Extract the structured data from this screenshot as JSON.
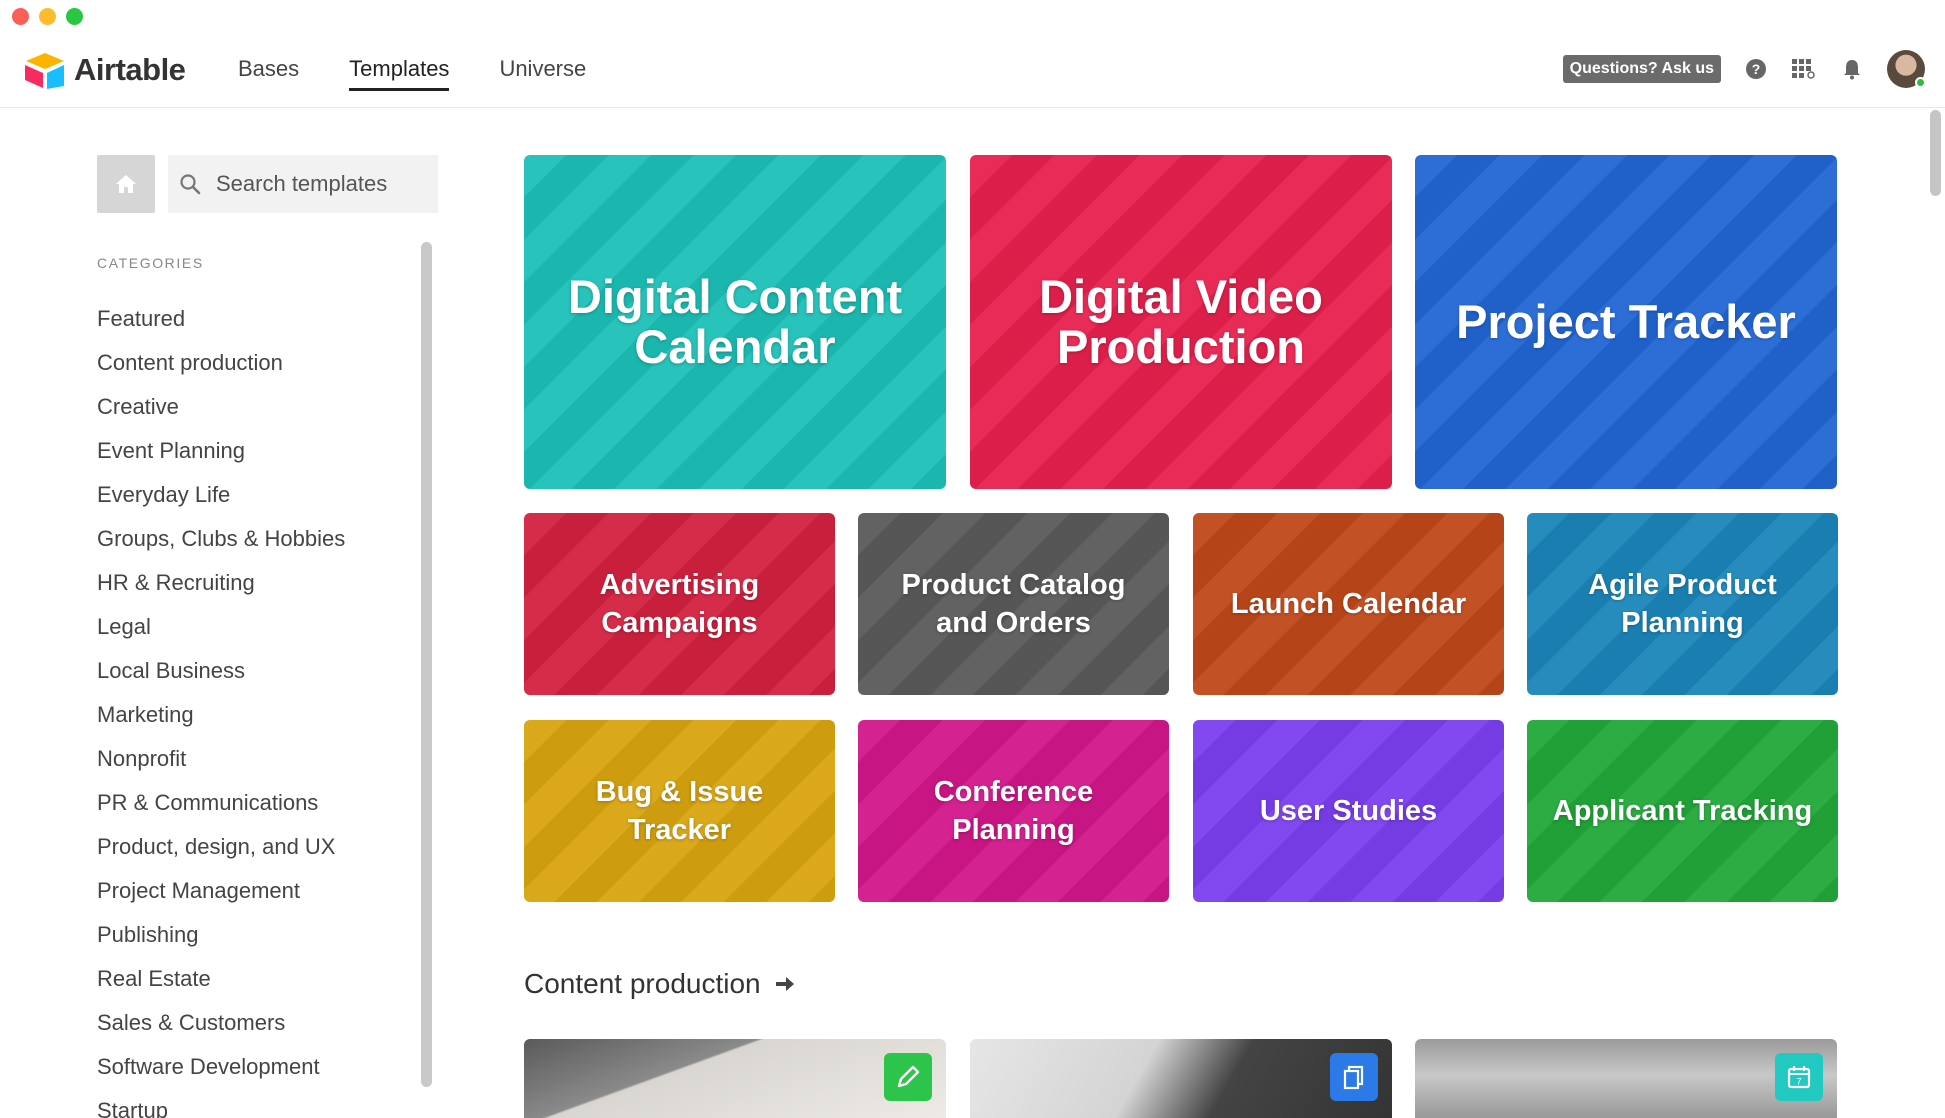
{
  "nav": {
    "logo_text": "Airtable",
    "links": [
      "Bases",
      "Templates",
      "Universe"
    ],
    "active": "Templates",
    "ask_label": "Questions? Ask us"
  },
  "sidebar": {
    "search_placeholder": "Search templates",
    "categories_heading": "CATEGORIES",
    "categories": [
      "Featured",
      "Content production",
      "Creative",
      "Event Planning",
      "Everyday Life",
      "Groups, Clubs & Hobbies",
      "HR & Recruiting",
      "Legal",
      "Local Business",
      "Marketing",
      "Nonprofit",
      "PR & Communications",
      "Product, design, and UX",
      "Project Management",
      "Publishing",
      "Real Estate",
      "Sales & Customers",
      "Software Development",
      "Startup"
    ]
  },
  "featured": {
    "big": [
      {
        "title": "Digital Content Calendar",
        "color": "#1cc0b7"
      },
      {
        "title": "Digital Video Production",
        "color": "#e8214e"
      },
      {
        "title": "Project Tracker",
        "color": "#2266d4"
      }
    ],
    "small": [
      {
        "title": "Advertising Campaigns",
        "color": "#d3213f"
      },
      {
        "title": "Product Catalog and Orders",
        "color": "#5a5a5a"
      },
      {
        "title": "Launch Calendar",
        "color": "#c0481a"
      },
      {
        "title": "Agile Product Planning",
        "color": "#1b86b9"
      },
      {
        "title": "Bug & Issue Tracker",
        "color": "#d9a410"
      },
      {
        "title": "Conference Planning",
        "color": "#d2168a"
      },
      {
        "title": "User Studies",
        "color": "#7b3ff0"
      },
      {
        "title": "Applicant Tracking",
        "color": "#22a83a"
      }
    ]
  },
  "content_production": {
    "title": "Content production",
    "badge_colors": [
      "#2cc44a",
      "#2b7ae8",
      "#22c9c0"
    ]
  }
}
